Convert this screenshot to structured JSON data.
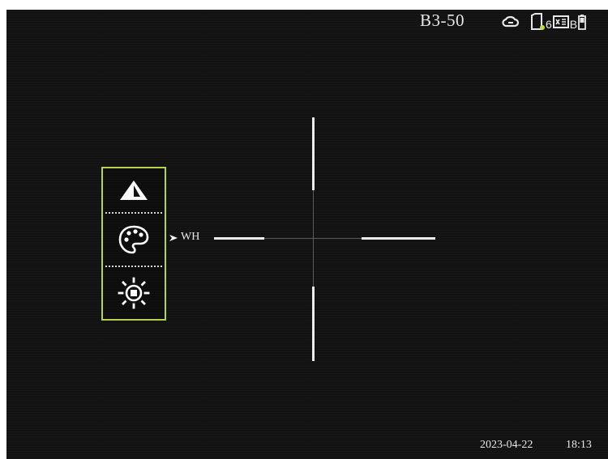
{
  "header": {
    "profile_label": "B3-50",
    "status": {
      "icons": [
        "cloud-link-icon",
        "sd-card-icon",
        "record-icon",
        "battery-icon"
      ],
      "sd_count": "6",
      "battery_letter": "B",
      "indicator_color": "#b8e04a"
    }
  },
  "menu": {
    "accent_color": "#b5d44a",
    "items": [
      {
        "icon": "warning-triangle-icon",
        "selected": false
      },
      {
        "icon": "palette-icon",
        "selected": true
      },
      {
        "icon": "brightness-icon",
        "selected": false
      }
    ],
    "selected_value": "WH"
  },
  "footer": {
    "date": "2023-04-22",
    "time": "18:13"
  }
}
